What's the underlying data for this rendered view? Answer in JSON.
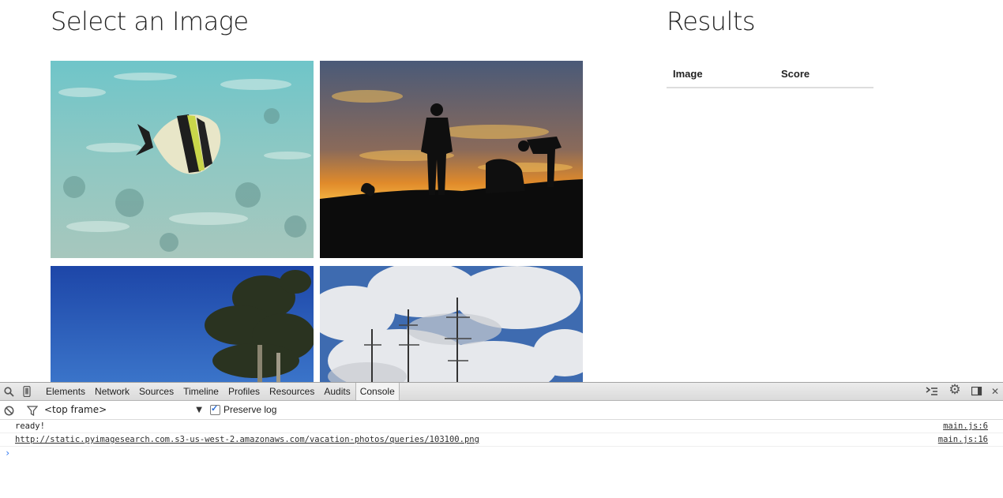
{
  "left": {
    "title": "Select an Image"
  },
  "right": {
    "title": "Results",
    "table": {
      "columns": [
        "Image",
        "Score"
      ]
    }
  },
  "images": [
    {
      "name": "underwater-fish-photo"
    },
    {
      "name": "sunset-silhouette-photo"
    },
    {
      "name": "blue-sky-tree-photo"
    },
    {
      "name": "cloudy-sky-ship-masts-photo"
    }
  ],
  "devtools": {
    "tabs": [
      "Elements",
      "Network",
      "Sources",
      "Timeline",
      "Profiles",
      "Resources",
      "Audits",
      "Console"
    ],
    "active_tab": "Console",
    "frame_select": "<top frame>",
    "preserve_log_label": "Preserve log",
    "preserve_log_checked": true,
    "console_lines": [
      {
        "message": "ready!",
        "source": "main.js:6"
      },
      {
        "message": "http://static.pyimagesearch.com.s3-us-west-2.amazonaws.com/vacation-photos/queries/103100.png",
        "source": "main.js:16"
      }
    ],
    "prompt_symbol": "›",
    "icons": [
      "search-icon",
      "device-mode-icon",
      "clear-console-icon",
      "filter-icon",
      "show-drawer-icon",
      "settings-gear-icon",
      "dock-side-icon",
      "close-icon"
    ]
  }
}
